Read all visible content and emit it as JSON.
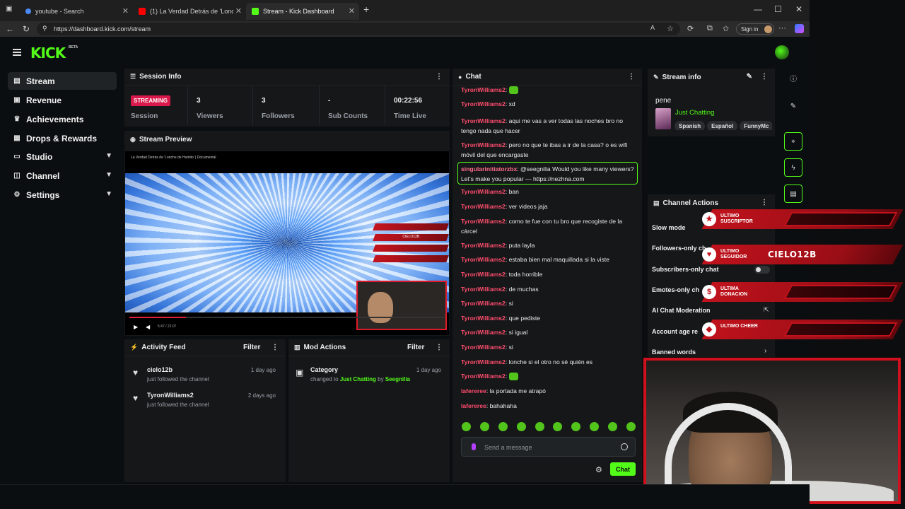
{
  "browser": {
    "tabs": [
      {
        "label": "youtube - Search"
      },
      {
        "label": "(1) La Verdad Detrás de 'Lonche d"
      },
      {
        "label": "Stream - Kick Dashboard"
      }
    ],
    "url": "https://dashboard.kick.com/stream",
    "signin_label": "Sign in"
  },
  "app": {
    "logo": "KICK",
    "beta": "BETA"
  },
  "sidebar": {
    "items": [
      {
        "label": "Stream",
        "icon": "stream-icon"
      },
      {
        "label": "Revenue",
        "icon": "revenue-icon"
      },
      {
        "label": "Achievements",
        "icon": "trophy-icon"
      },
      {
        "label": "Drops & Rewards",
        "icon": "gift-icon"
      },
      {
        "label": "Studio",
        "icon": "studio-icon"
      },
      {
        "label": "Channel",
        "icon": "channel-icon"
      },
      {
        "label": "Settings",
        "icon": "gear-icon"
      }
    ]
  },
  "session": {
    "title": "Session Info",
    "status": "STREAMING",
    "status_label": "Session",
    "viewers": "3",
    "viewers_label": "Viewers",
    "followers": "3",
    "followers_label": "Followers",
    "subs": "-",
    "subs_label": "Sub Counts",
    "time_live": "00:22:56",
    "time_live_label": "Time Live"
  },
  "preview": {
    "title": "Stream Preview",
    "video_title": "La Verdad Detrás de 'Lonche de Humito' | Documental",
    "overlay_mini_value": "CIELO12B",
    "time": "5:47 / 22:07"
  },
  "activity": {
    "title": "Activity Feed",
    "filter": "Filter",
    "items": [
      {
        "name": "cielo12b",
        "desc": "just followed the channel",
        "time": "1 day ago"
      },
      {
        "name": "TyronWilliams2",
        "desc": "just followed the channel",
        "time": "2 days ago"
      }
    ]
  },
  "mod": {
    "title": "Mod Actions",
    "filter": "Filter",
    "item": {
      "name": "Category",
      "desc_prefix": "changed to",
      "category": "Just Chatting",
      "by": "by",
      "user": "Seegnilia",
      "time": "1 day ago"
    }
  },
  "chat": {
    "title": "Chat",
    "messages": [
      {
        "user": "TyronWilliams2",
        "text": "",
        "emote": true
      },
      {
        "user": "TyronWilliams2",
        "text": "xd"
      },
      {
        "user": "TyronWilliams2",
        "text": "aqui me vas a ver todas las noches bro no tengo nada que hacer"
      },
      {
        "user": "TyronWilliams2",
        "text": "pero no que te ibas a ir de la casa? o es wifi móvil del que encargaste"
      },
      {
        "user": "singularinitiatorzbx",
        "text": "@seegnilia Would you like many viewers? Let's make you popular — https://nezhna.com",
        "highlight": true
      },
      {
        "user": "TyronWilliams2",
        "text": "ban"
      },
      {
        "user": "TyronWilliams2",
        "text": "ver videos jaja"
      },
      {
        "user": "TyronWilliams2",
        "text": "como te fue con tu bro que recogiste de la cárcel"
      },
      {
        "user": "TyronWilliams2",
        "text": "puta layla"
      },
      {
        "user": "TyronWilliams2",
        "text": "estaba bien mal maquillada si la viste"
      },
      {
        "user": "TyronWilliams2",
        "text": "toda horrible"
      },
      {
        "user": "TyronWilliams2",
        "text": "de muchas"
      },
      {
        "user": "TyronWilliams2",
        "text": "si"
      },
      {
        "user": "TyronWilliams2",
        "text": "que pediste"
      },
      {
        "user": "TyronWilliams2",
        "text": "si igual"
      },
      {
        "user": "TyronWilliams2",
        "text": "si"
      },
      {
        "user": "TyronWilliams2",
        "text": "lonche si el otro no sé quién es"
      },
      {
        "user": "TyronWilliams2",
        "text": "",
        "emote": true
      },
      {
        "user": "laferereе",
        "text": "la portada me atrapó"
      },
      {
        "user": "laferereе",
        "text": "bahahaha"
      }
    ],
    "input_placeholder": "Send a message",
    "send_label": "Chat",
    "colors": {
      "user": "#ff4d6d",
      "highlight_user": "#ff6b8a",
      "accent": "#53fc18"
    }
  },
  "stream_info": {
    "title": "Stream info",
    "stream_title": "pene",
    "category": "Just Chatting",
    "tags": [
      "Spanish",
      "Español",
      "FunnyMc"
    ]
  },
  "channel_actions": {
    "title": "Channel Actions",
    "rows": [
      {
        "label": "Slow mode"
      },
      {
        "label": "Followers-only ch"
      },
      {
        "label": "Subscribers-only chat"
      },
      {
        "label": "Emotes-only ch"
      },
      {
        "label": "AI Chat Moderation"
      },
      {
        "label": "Account age re"
      },
      {
        "label": "Banned words"
      }
    ]
  },
  "overlay": {
    "items": [
      {
        "label": "ULTIMO SUSCRIPTOR",
        "value": ""
      },
      {
        "label": "ULTIMO SEGUIDOR",
        "value": "CIELO12B"
      },
      {
        "label": "ULTIMA DONACION",
        "value": ""
      },
      {
        "label": "ULTIMO CHEER",
        "value": ""
      }
    ],
    "accent": "#c0121c"
  }
}
